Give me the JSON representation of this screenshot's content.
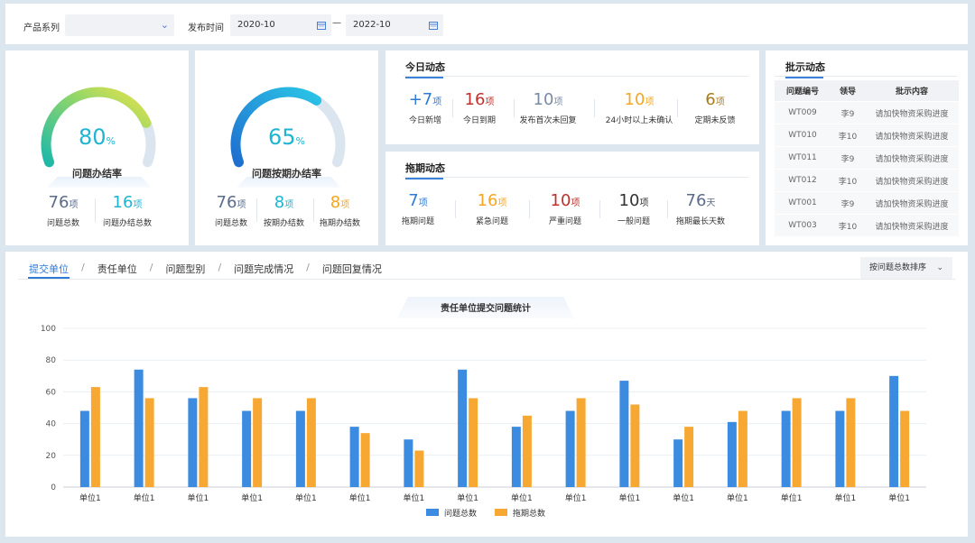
{
  "filter": {
    "series_label": "产品系列",
    "series_value": "",
    "time_label": "发布时间",
    "start": "2020-10",
    "dash": "—",
    "end": "2022-10"
  },
  "gauge1": {
    "value": "80",
    "unit": "%",
    "percent": 80,
    "title": "问题办结率",
    "stats": [
      {
        "num": "76",
        "unit": "项",
        "label": "问题总数",
        "color": "#5b6b8c"
      },
      {
        "num": "16",
        "unit": "项",
        "label": "问题办结总数",
        "color": "#1fb4d2"
      }
    ]
  },
  "gauge2": {
    "value": "65",
    "unit": "%",
    "percent": 65,
    "title": "问题按期办结率",
    "stats": [
      {
        "num": "76",
        "unit": "项",
        "label": "问题总数",
        "color": "#5b6b8c"
      },
      {
        "num": "8",
        "unit": "项",
        "label": "按期办结数",
        "color": "#1fb4d2"
      },
      {
        "num": "8",
        "unit": "项",
        "label": "拖期办结数",
        "color": "#f5a623"
      }
    ]
  },
  "today": {
    "title": "今日动态",
    "stats": [
      {
        "num": "+7",
        "unit": "项",
        "label": "今日新增",
        "color": "#2f7ad6"
      },
      {
        "num": "16",
        "unit": "项",
        "label": "今日到期",
        "color": "#c0312b"
      },
      {
        "num": "10",
        "unit": "项",
        "label": "发布首次未回复",
        "color": "#7b8aa5"
      },
      {
        "num": "10",
        "unit": "项",
        "label": "24小时以上未确认",
        "color": "#f5a623"
      },
      {
        "num": "6",
        "unit": "项",
        "label": "定期未反馈",
        "color": "#a87c1a"
      }
    ]
  },
  "delay": {
    "title": "拖期动态",
    "stats": [
      {
        "num": "7",
        "unit": "项",
        "label": "拖期问题",
        "color": "#2f7ad6"
      },
      {
        "num": "16",
        "unit": "项",
        "label": "紧急问题",
        "color": "#f5a623"
      },
      {
        "num": "10",
        "unit": "项",
        "label": "严重问题",
        "color": "#c0312b"
      },
      {
        "num": "10",
        "unit": "项",
        "label": "一般问题",
        "color": "#333333"
      },
      {
        "num": "76",
        "unit": "天",
        "label": "拖期最长天数",
        "color": "#5b6b8c"
      }
    ]
  },
  "instructions": {
    "title": "批示动态",
    "headers": [
      "问题编号",
      "领导",
      "批示内容"
    ],
    "rows": [
      [
        "WT009",
        "李9",
        "请加快物资采购进度"
      ],
      [
        "WT010",
        "李10",
        "请加快物资采购进度"
      ],
      [
        "WT011",
        "李9",
        "请加快物资采购进度"
      ],
      [
        "WT012",
        "李10",
        "请加快物资采购进度"
      ],
      [
        "WT001",
        "李9",
        "请加快物资采购进度"
      ],
      [
        "WT003",
        "李10",
        "请加快物资采购进度"
      ]
    ]
  },
  "tabs": {
    "items": [
      "提交单位",
      "责任单位",
      "问题型别",
      "问题完成情况",
      "问题回复情况"
    ],
    "separator": "/",
    "active": 0
  },
  "sort": {
    "label": "按问题总数排序"
  },
  "chart_data": {
    "type": "bar",
    "title": "责任单位提交问题统计",
    "categories": [
      "单位1",
      "单位1",
      "单位1",
      "单位1",
      "单位1",
      "单位1",
      "单位1",
      "单位1",
      "单位1",
      "单位1",
      "单位1",
      "单位1",
      "单位1",
      "单位1",
      "单位1",
      "单位1"
    ],
    "series": [
      {
        "name": "问题总数",
        "color": "#3b8be0",
        "values": [
          48,
          74,
          56,
          48,
          48,
          38,
          30,
          74,
          38,
          48,
          67,
          30,
          41,
          48,
          48,
          70
        ]
      },
      {
        "name": "拖期总数",
        "color": "#f7a832",
        "values": [
          63,
          56,
          63,
          56,
          56,
          34,
          23,
          56,
          45,
          56,
          52,
          38,
          48,
          56,
          56,
          48
        ]
      }
    ],
    "ylim": [
      0,
      100
    ],
    "yticks": [
      0,
      20,
      40,
      60,
      80,
      100
    ],
    "grid": true,
    "legend": "bottom"
  }
}
